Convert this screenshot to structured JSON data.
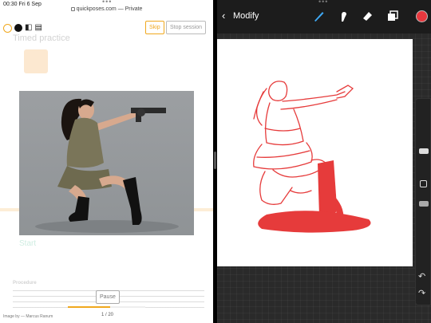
{
  "browser": {
    "status_time": "00:30 Fri 6 Sep",
    "url_text": "quickposes.com — Private",
    "bg_heading": "Timed practice",
    "bg_start": "Start",
    "bg_section": "Procedure"
  },
  "session": {
    "skip_label": "Skip",
    "stop_label": "Stop session",
    "pause_label": "Pause",
    "counter": "1 / 20",
    "progress_fraction": 0.55,
    "credit": "Image by — Marcus Ranum",
    "accent_color": "#f0a81e"
  },
  "app": {
    "back_label": "Modify",
    "tools": [
      "brush-icon",
      "smudge-icon",
      "eraser-icon",
      "layers-icon"
    ],
    "current_color": "#e8383e"
  }
}
